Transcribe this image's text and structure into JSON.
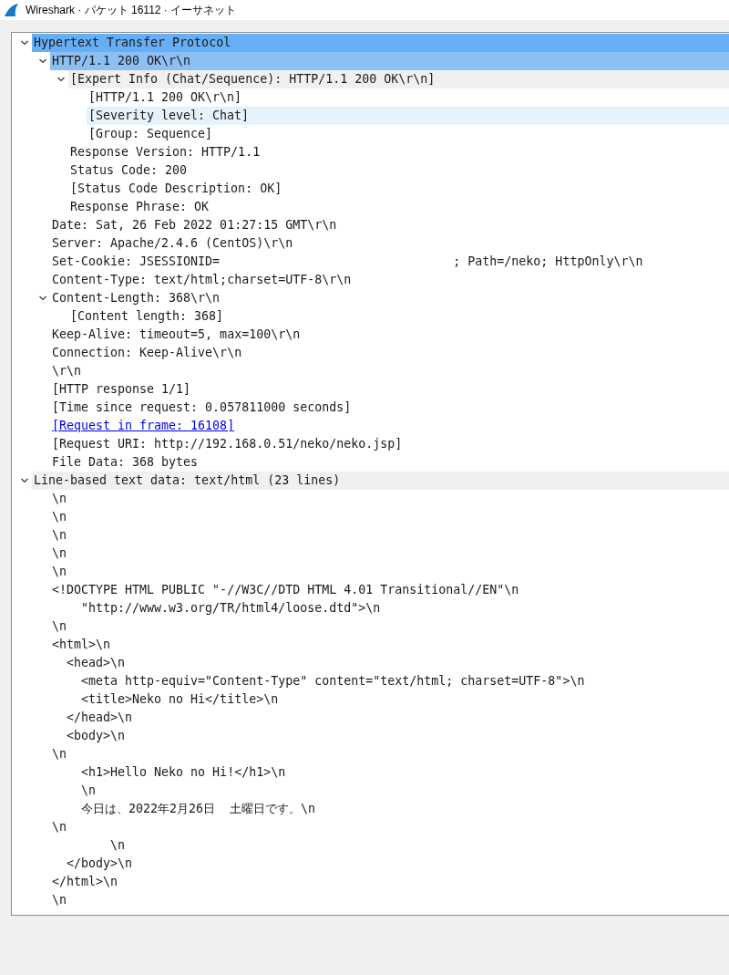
{
  "window": {
    "title": "Wireshark · パケット 16112 · イーサネット"
  },
  "tree": [
    {
      "text": "Hypertext Transfer Protocol",
      "selected": true,
      "related": false,
      "shaded": false,
      "hovered": false,
      "expanded": true,
      "children": [
        {
          "text": "HTTP/1.1 200 OK\\r\\n",
          "selected": false,
          "related": true,
          "shaded": false,
          "hovered": false,
          "expanded": true,
          "children": [
            {
              "text": "[Expert Info (Chat/Sequence): HTTP/1.1 200 OK\\r\\n]",
              "selected": false,
              "related": false,
              "shaded": true,
              "hovered": false,
              "expanded": true,
              "children": [
                {
                  "text": "[HTTP/1.1 200 OK\\r\\n]",
                  "selected": false,
                  "related": false,
                  "shaded": false,
                  "hovered": false
                },
                {
                  "text": "[Severity level: Chat]",
                  "selected": false,
                  "related": false,
                  "shaded": false,
                  "hovered": true
                },
                {
                  "text": "[Group: Sequence]",
                  "selected": false,
                  "related": false,
                  "shaded": false,
                  "hovered": false
                }
              ]
            },
            {
              "text": "Response Version: HTTP/1.1",
              "selected": false,
              "related": false,
              "shaded": false,
              "hovered": false
            },
            {
              "text": "Status Code: 200",
              "selected": false,
              "related": false,
              "shaded": false,
              "hovered": false
            },
            {
              "text": "[Status Code Description: OK]",
              "selected": false,
              "related": false,
              "shaded": false,
              "hovered": false
            },
            {
              "text": "Response Phrase: OK",
              "selected": false,
              "related": false,
              "shaded": false,
              "hovered": false
            }
          ]
        },
        {
          "text": "Date: Sat, 26 Feb 2022 01:27:15 GMT\\r\\n",
          "selected": false,
          "related": false,
          "shaded": false,
          "hovered": false
        },
        {
          "text": "Server: Apache/2.4.6 (CentOS)\\r\\n",
          "selected": false,
          "related": false,
          "shaded": false,
          "hovered": false
        },
        {
          "text": "Set-Cookie: JSESSIONID=                                ; Path=/neko; HttpOnly\\r\\n",
          "selected": false,
          "related": false,
          "shaded": false,
          "hovered": false
        },
        {
          "text": "Content-Type: text/html;charset=UTF-8\\r\\n",
          "selected": false,
          "related": false,
          "shaded": false,
          "hovered": false
        },
        {
          "text": "Content-Length: 368\\r\\n",
          "selected": false,
          "related": false,
          "shaded": false,
          "hovered": false,
          "expanded": true,
          "children": [
            {
              "text": "[Content length: 368]",
              "selected": false,
              "related": false,
              "shaded": false,
              "hovered": false
            }
          ]
        },
        {
          "text": "Keep-Alive: timeout=5, max=100\\r\\n",
          "selected": false,
          "related": false,
          "shaded": false,
          "hovered": false
        },
        {
          "text": "Connection: Keep-Alive\\r\\n",
          "selected": false,
          "related": false,
          "shaded": false,
          "hovered": false
        },
        {
          "text": "\\r\\n",
          "selected": false,
          "related": false,
          "shaded": false,
          "hovered": false
        },
        {
          "text": "[HTTP response 1/1]",
          "selected": false,
          "related": false,
          "shaded": false,
          "hovered": false
        },
        {
          "text": "[Time since request: 0.057811000 seconds]",
          "selected": false,
          "related": false,
          "shaded": false,
          "hovered": false
        },
        {
          "text": "[Request in frame: 16108]",
          "selected": false,
          "related": false,
          "shaded": false,
          "hovered": false,
          "kind": "link"
        },
        {
          "text": "[Request URI: http://192.168.0.51/neko/neko.jsp]",
          "selected": false,
          "related": false,
          "shaded": false,
          "hovered": false
        },
        {
          "text": "File Data: 368 bytes",
          "selected": false,
          "related": false,
          "shaded": false,
          "hovered": false
        }
      ]
    },
    {
      "text": "Line-based text data: text/html (23 lines)",
      "selected": false,
      "related": false,
      "shaded": true,
      "hovered": false,
      "expanded": true,
      "children": [
        {
          "text": "\\n",
          "selected": false,
          "related": false,
          "shaded": false,
          "hovered": false
        },
        {
          "text": "\\n",
          "selected": false,
          "related": false,
          "shaded": false,
          "hovered": false
        },
        {
          "text": "\\n",
          "selected": false,
          "related": false,
          "shaded": false,
          "hovered": false
        },
        {
          "text": "\\n",
          "selected": false,
          "related": false,
          "shaded": false,
          "hovered": false
        },
        {
          "text": "\\n",
          "selected": false,
          "related": false,
          "shaded": false,
          "hovered": false
        },
        {
          "text": "<!DOCTYPE HTML PUBLIC \"-//W3C//DTD HTML 4.01 Transitional//EN\"\\n",
          "selected": false,
          "related": false,
          "shaded": false,
          "hovered": false
        },
        {
          "text": "    \"http://www.w3.org/TR/html4/loose.dtd\">\\n",
          "selected": false,
          "related": false,
          "shaded": false,
          "hovered": false
        },
        {
          "text": "\\n",
          "selected": false,
          "related": false,
          "shaded": false,
          "hovered": false
        },
        {
          "text": "<html>\\n",
          "selected": false,
          "related": false,
          "shaded": false,
          "hovered": false
        },
        {
          "text": "  <head>\\n",
          "selected": false,
          "related": false,
          "shaded": false,
          "hovered": false
        },
        {
          "text": "    <meta http-equiv=\"Content-Type\" content=\"text/html; charset=UTF-8\">\\n",
          "selected": false,
          "related": false,
          "shaded": false,
          "hovered": false
        },
        {
          "text": "    <title>Neko no Hi</title>\\n",
          "selected": false,
          "related": false,
          "shaded": false,
          "hovered": false
        },
        {
          "text": "  </head>\\n",
          "selected": false,
          "related": false,
          "shaded": false,
          "hovered": false
        },
        {
          "text": "  <body>\\n",
          "selected": false,
          "related": false,
          "shaded": false,
          "hovered": false
        },
        {
          "text": "\\n",
          "selected": false,
          "related": false,
          "shaded": false,
          "hovered": false
        },
        {
          "text": "    <h1>Hello Neko no Hi!</h1>\\n",
          "selected": false,
          "related": false,
          "shaded": false,
          "hovered": false
        },
        {
          "text": "    \\n",
          "selected": false,
          "related": false,
          "shaded": false,
          "hovered": false
        },
        {
          "text": "    今日は、2022年2月26日  土曜日です。\\n",
          "selected": false,
          "related": false,
          "shaded": false,
          "hovered": false
        },
        {
          "text": "\\n",
          "selected": false,
          "related": false,
          "shaded": false,
          "hovered": false
        },
        {
          "text": "        \\n",
          "selected": false,
          "related": false,
          "shaded": false,
          "hovered": false
        },
        {
          "text": "  </body>\\n",
          "selected": false,
          "related": false,
          "shaded": false,
          "hovered": false
        },
        {
          "text": "</html>\\n",
          "selected": false,
          "related": false,
          "shaded": false,
          "hovered": false
        },
        {
          "text": "\\n",
          "selected": false,
          "related": false,
          "shaded": false,
          "hovered": false
        }
      ]
    }
  ]
}
